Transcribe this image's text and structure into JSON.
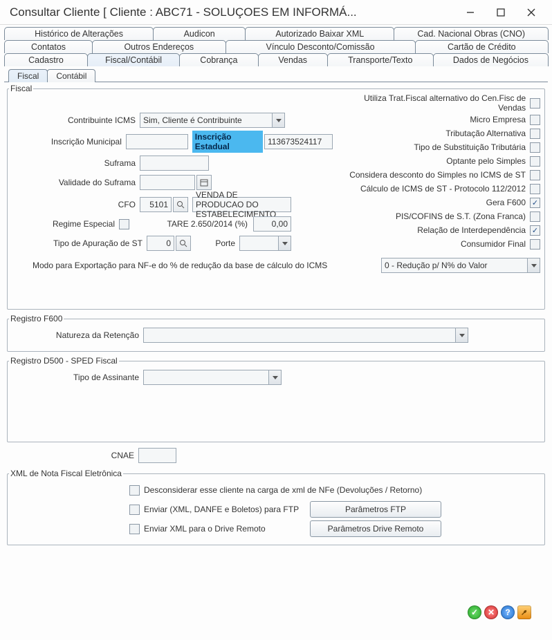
{
  "window": {
    "title": "Consultar Cliente [ Cliente : ABC71 - SOLUÇOES EM INFORMÁ..."
  },
  "tabs_row1": [
    "Histórico de Alterações",
    "Audicon",
    "Autorizado Baixar XML",
    "Cad. Nacional Obras (CNO)"
  ],
  "tabs_row2": [
    "Contatos",
    "Outros Endereços",
    "Vínculo Desconto/Comissão",
    "Cartão de Crédito"
  ],
  "tabs_row3": [
    "Cadastro",
    "Fiscal/Contábil",
    "Cobrança",
    "Vendas",
    "Transporte/Texto",
    "Dados de Negócios"
  ],
  "subtabs": [
    "Fiscal",
    "Contábil"
  ],
  "fiscal": {
    "legend": "Fiscal",
    "contribuinte_icms_label": "Contribuinte ICMS",
    "contribuinte_icms_value": "Sim, Cliente é Contribuinte",
    "inscricao_municipal_label": "Inscrição Municipal",
    "inscricao_municipal_value": "",
    "inscricao_estadual_label": "Inscrição Estadual",
    "inscricao_estadual_value": "113673524117",
    "suframa_label": "Suframa",
    "suframa_value": "",
    "validade_suframa_label": "Validade do Suframa",
    "validade_suframa_value": "",
    "cfo_label": "CFO",
    "cfo_code": "5101",
    "cfo_desc": "VENDA DE PRODUCAO DO ESTABELECIMENTO",
    "regime_especial_label": "Regime Especial",
    "tare_label": "TARE 2.650/2014 (%)",
    "tare_value": "0,00",
    "tipo_apuracao_label": "Tipo de Apuração de ST",
    "tipo_apuracao_value": "0",
    "porte_label": "Porte",
    "porte_value": "",
    "modo_export_label": "Modo para Exportação para NF-e do % de redução da base de cálculo do ICMS",
    "modo_export_value": "0 - Redução p/ N% do Valor",
    "checks": {
      "trat_fiscal_alt": "Utiliza Trat.Fiscal alternativo do Cen.Fisc de Vendas",
      "micro_empresa": "Micro Empresa",
      "tributacao_alt": "Tributação Alternativa",
      "tipo_subst": "Tipo de Substituição Tributária",
      "optante_simples": "Optante pelo Simples",
      "desc_simples_icms_st": "Considera desconto do Simples no ICMS de ST",
      "calc_icms_st": "Cálculo de ICMS de ST - Protocolo 112/2012",
      "gera_f600": "Gera F600",
      "pis_cofins_st": "PIS/COFINS de S.T. (Zona Franca)",
      "relacao_interdep": "Relação de Interdependência",
      "consumidor_final": "Consumidor Final"
    }
  },
  "f600": {
    "legend": "Registro F600",
    "natureza_label": "Natureza da Retenção",
    "natureza_value": ""
  },
  "d500": {
    "legend": "Registro D500 - SPED Fiscal",
    "tipo_assinante_label": "Tipo de Assinante",
    "tipo_assinante_value": ""
  },
  "cnae": {
    "label": "CNAE",
    "value": ""
  },
  "xml_nfe": {
    "legend": "XML de Nota Fiscal Eletrônica",
    "desconsiderar": "Desconsiderar esse cliente na carga de xml de NFe (Devoluções / Retorno)",
    "enviar_ftp": "Enviar (XML, DANFE e Boletos) para FTP",
    "btn_param_ftp": "Parâmetros FTP",
    "enviar_drive": "Enviar XML para o Drive Remoto",
    "btn_param_drive": "Parâmetros Drive Remoto"
  }
}
